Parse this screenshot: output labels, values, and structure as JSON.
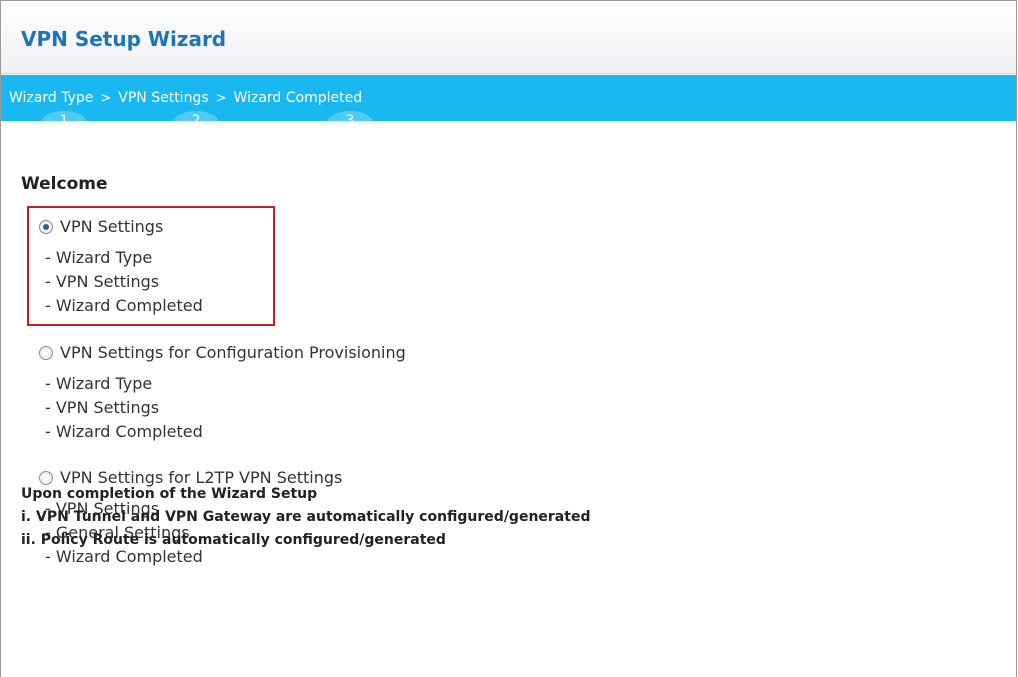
{
  "window": {
    "title": "VPN Setup Wizard"
  },
  "steps": [
    {
      "label": "Wizard Type",
      "number": "1"
    },
    {
      "label": "VPN Settings",
      "number": "2"
    },
    {
      "label": "Wizard Completed",
      "number": "3"
    }
  ],
  "step_separator": ">",
  "main": {
    "heading": "Welcome",
    "options": [
      {
        "label": "VPN Settings",
        "selected": true,
        "items": [
          "- Wizard Type",
          "- VPN Settings",
          "- Wizard Completed"
        ]
      },
      {
        "label": "VPN Settings for Configuration Provisioning",
        "selected": false,
        "items": [
          "- Wizard Type",
          "- VPN Settings",
          "- Wizard Completed"
        ]
      },
      {
        "label": "VPN Settings for L2TP VPN Settings",
        "selected": false,
        "items": [
          "- VPN Settings",
          "- General Settings",
          "- Wizard Completed"
        ]
      }
    ],
    "notes": [
      "Upon completion of the Wizard Setup",
      "i. VPN Tunnel and VPN Gateway are automatically configured/generated",
      "ii. Policy Route is automatically configured/generated"
    ]
  },
  "colors": {
    "accent": "#1ab8f0",
    "title": "#1f74b8",
    "highlight": "#c0202a"
  }
}
